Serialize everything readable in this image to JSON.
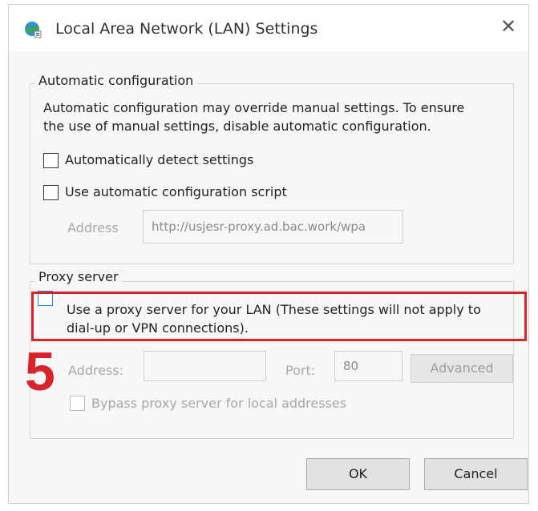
{
  "window": {
    "title": "Local Area Network (LAN) Settings",
    "icon": "globe-settings-icon",
    "close_icon": "close-icon"
  },
  "auto_config": {
    "legend": "Automatic configuration",
    "description_line1": "Automatic configuration may override manual settings.  To ensure",
    "description_line2": "the use of manual settings, disable automatic configuration.",
    "detect_label": "Automatically detect settings",
    "script_label": "Use automatic configuration script",
    "address_label": "Address",
    "address_value": "http://usjesr-proxy.ad.bac.work/wpa"
  },
  "proxy": {
    "legend": "Proxy server",
    "use_proxy_line1": "Use a proxy server for your LAN (These settings will not apply to",
    "use_proxy_line2": "dial-up or VPN connections).",
    "address_label": "Address:",
    "address_value": "",
    "port_label": "Port:",
    "port_value": "80",
    "advanced_label": "Advanced",
    "bypass_label": "Bypass proxy server for local addresses"
  },
  "annotation": {
    "step_number": "5",
    "highlight_color": "#d8232a"
  },
  "buttons": {
    "ok": "OK",
    "cancel": "Cancel"
  }
}
